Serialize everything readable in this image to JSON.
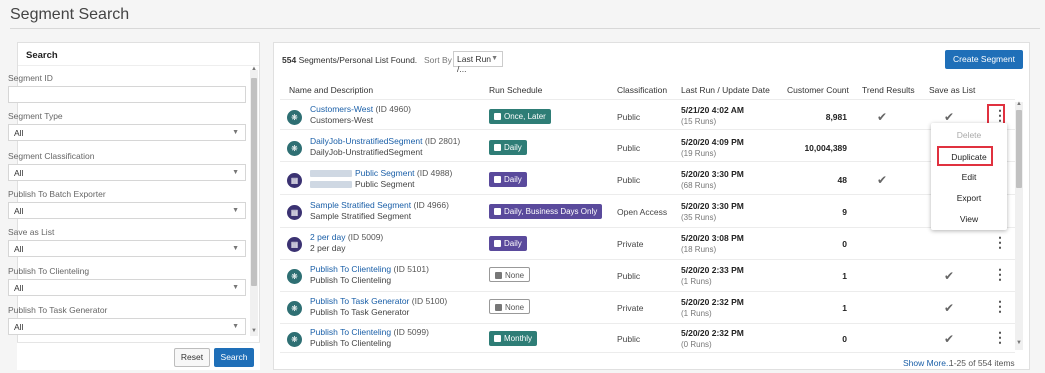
{
  "page": {
    "title": "Segment Search"
  },
  "search_panel": {
    "header": "Search",
    "filters": [
      {
        "label": "Segment ID",
        "value": "",
        "type": "text"
      },
      {
        "label": "Segment Type",
        "value": "All",
        "type": "select"
      },
      {
        "label": "Segment Classification",
        "value": "All",
        "type": "select"
      },
      {
        "label": "Publish To Batch Exporter",
        "value": "All",
        "type": "select"
      },
      {
        "label": "Save as List",
        "value": "All",
        "type": "select"
      },
      {
        "label": "Publish To Clienteling",
        "value": "All",
        "type": "select"
      },
      {
        "label": "Publish To Task Generator",
        "value": "All",
        "type": "select"
      }
    ],
    "reset_label": "Reset",
    "search_label": "Search"
  },
  "results": {
    "found_count": "554",
    "found_text": "Segments/Personal List Found.",
    "sort_label": "Sort By",
    "sort_value": "Last Run /...",
    "create_label": "Create Segment",
    "columns": [
      "Name and Description",
      "Run Schedule",
      "Classification",
      "Last Run / Update Date",
      "Customer Count",
      "Trend Results",
      "Save as List"
    ],
    "rows": [
      {
        "name": "Customers-West",
        "id": "(ID 4960)",
        "desc": "Customers-West",
        "schedule": "Once, Later",
        "schedule_style": "teal",
        "classification": "Public",
        "last_run": "5/21/20 4:02 AM",
        "runs": "(15 Runs)",
        "count": "8,981",
        "trend": true,
        "save_list": true
      },
      {
        "name": "DailyJob-UnstratifiedSegment",
        "id": "(ID 2801)",
        "desc": "DailyJob-UnstratifiedSegment",
        "schedule": "Daily",
        "schedule_style": "teal",
        "classification": "Public",
        "last_run": "5/20/20 4:09 PM",
        "runs": "(19 Runs)",
        "count": "10,004,389",
        "trend": false,
        "save_list": false
      },
      {
        "name": "Public Segment",
        "id": "(ID 4988)",
        "desc": "Public Segment",
        "schedule": "Daily",
        "schedule_style": "purple",
        "classification": "Public",
        "last_run": "5/20/20 3:30 PM",
        "runs": "(68 Runs)",
        "count": "48",
        "trend": true,
        "save_list": false
      },
      {
        "name": "Sample Stratified Segment",
        "id": "(ID 4966)",
        "desc": "Sample Stratified Segment",
        "schedule": "Daily, Business Days Only",
        "schedule_style": "purple",
        "classification": "Open Access",
        "last_run": "5/20/20 3:30 PM",
        "runs": "(35 Runs)",
        "count": "9",
        "trend": false,
        "save_list": false
      },
      {
        "name": "2 per day",
        "id": "(ID 5009)",
        "desc": "2 per day",
        "schedule": "Daily",
        "schedule_style": "purple",
        "classification": "Private",
        "last_run": "5/20/20 3:08 PM",
        "runs": "(18 Runs)",
        "count": "0",
        "trend": false,
        "save_list": false
      },
      {
        "name": "Publish To Clienteling",
        "id": "(ID 5101)",
        "desc": "Publish To Clienteling",
        "schedule": "None",
        "schedule_style": "none",
        "classification": "Public",
        "last_run": "5/20/20 2:33 PM",
        "runs": "(1 Runs)",
        "count": "1",
        "trend": false,
        "save_list": true
      },
      {
        "name": "Publish To Task Generator",
        "id": "(ID 5100)",
        "desc": "Publish To Task Generator",
        "schedule": "None",
        "schedule_style": "none",
        "classification": "Private",
        "last_run": "5/20/20 2:32 PM",
        "runs": "(1 Runs)",
        "count": "1",
        "trend": false,
        "save_list": true
      },
      {
        "name": "Publish To Clienteling",
        "id": "(ID 5099)",
        "desc": "Publish To Clienteling",
        "schedule": "Monthly",
        "schedule_style": "teal",
        "classification": "Public",
        "last_run": "5/20/20 2:32 PM",
        "runs": "(0 Runs)",
        "count": "0",
        "trend": false,
        "save_list": true
      }
    ],
    "row_menu": [
      "Delete",
      "Duplicate",
      "Edit",
      "Export",
      "View"
    ],
    "show_more": "Show More...",
    "items_range": "1-25 of 554 items"
  }
}
